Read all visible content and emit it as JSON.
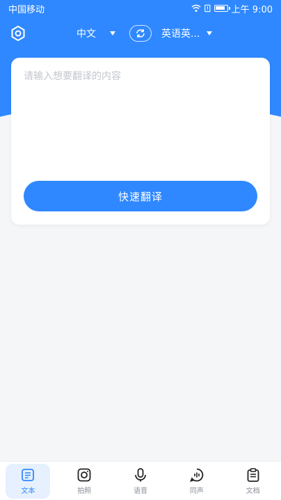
{
  "status_bar": {
    "carrier": "中国移动",
    "time": "上午 9:00"
  },
  "header": {
    "source_language": "中文",
    "target_language": "英语英..."
  },
  "translator": {
    "input_placeholder": "请输入想要翻译的内容",
    "translate_button": "快速翻译"
  },
  "bottom_nav": {
    "items": [
      {
        "label": "文本",
        "icon": "text-icon",
        "active": true
      },
      {
        "label": "拍照",
        "icon": "camera-icon",
        "active": false
      },
      {
        "label": "语音",
        "icon": "microphone-icon",
        "active": false
      },
      {
        "label": "同声",
        "icon": "simultaneous-icon",
        "active": false
      },
      {
        "label": "文档",
        "icon": "document-icon",
        "active": false
      }
    ]
  },
  "colors": {
    "accent": "#2f88ff",
    "background": "#f5f6f8"
  }
}
